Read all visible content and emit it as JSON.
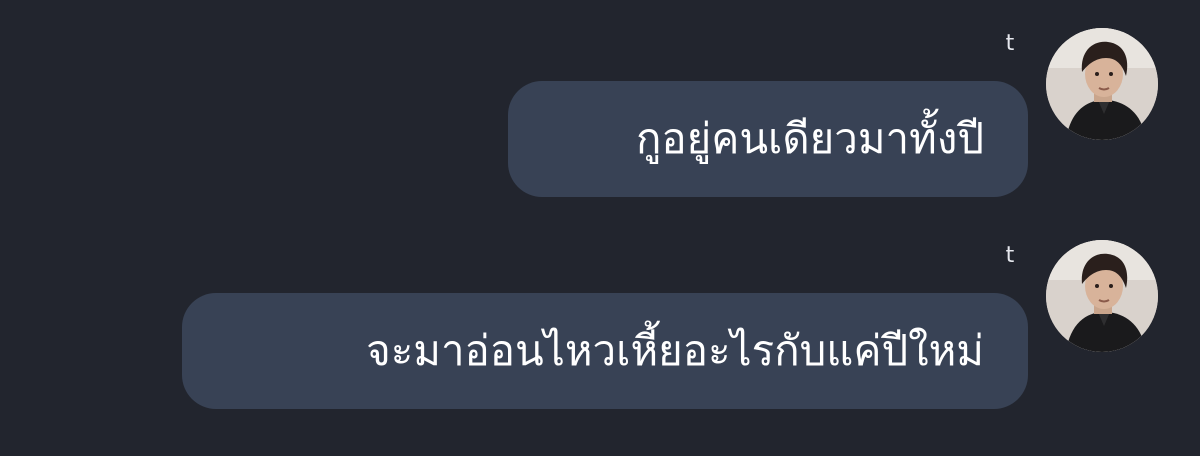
{
  "chat": {
    "messages": [
      {
        "sender": "t",
        "text": "กูอยู่คนเดียวมาทั้งปี",
        "avatar_icon": "user-avatar-icon"
      },
      {
        "sender": "t",
        "text": "จะมาอ่อนไหวเหี้ยอะไรกับแค่ปีใหม่",
        "avatar_icon": "user-avatar-icon"
      }
    ]
  },
  "colors": {
    "background": "#22252e",
    "bubble": "#384255",
    "text": "#ffffff"
  }
}
